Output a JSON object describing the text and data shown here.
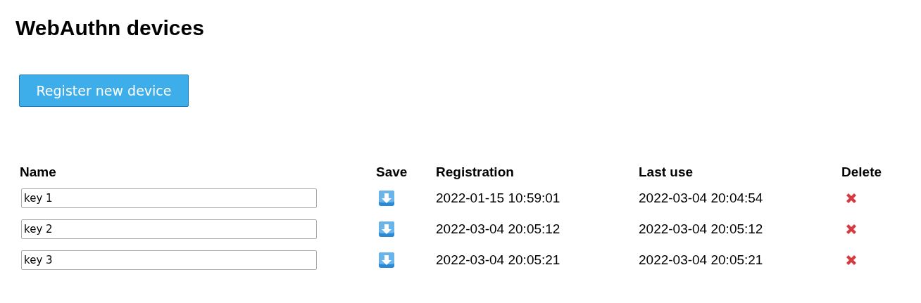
{
  "title": "WebAuthn devices",
  "register_button": "Register new device",
  "table": {
    "columns": [
      "Name",
      "Save",
      "Registration",
      "Last use",
      "Delete"
    ],
    "rows": [
      {
        "name": "key 1",
        "registration": "2022-01-15 10:59:01",
        "last_use": "2022-03-04 20:04:54"
      },
      {
        "name": "key 2",
        "registration": "2022-03-04 20:05:12",
        "last_use": "2022-03-04 20:05:12"
      },
      {
        "name": "key 3",
        "registration": "2022-03-04 20:05:21",
        "last_use": "2022-03-04 20:05:21"
      }
    ]
  }
}
